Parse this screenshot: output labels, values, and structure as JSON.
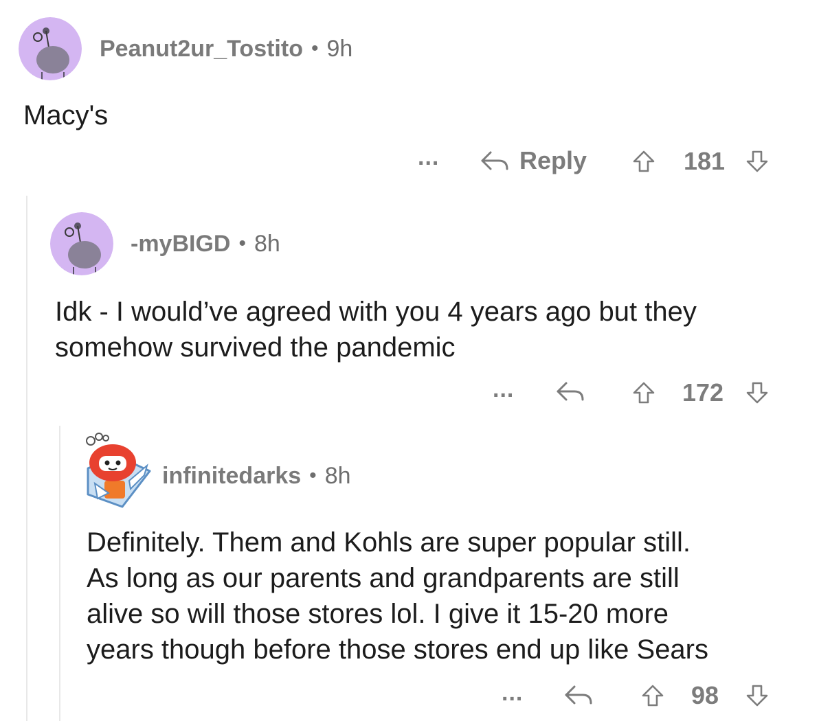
{
  "comments": [
    {
      "username": "Peanut2ur_Tostito",
      "separator": "•",
      "age": "9h",
      "text": "Macy's",
      "more_label": "...",
      "reply_label": "Reply",
      "score": "181"
    },
    {
      "username": "-myBIGD",
      "separator": "•",
      "age": "8h",
      "text_lines": [
        "Idk - I would’ve agreed with you 4 years ago but they",
        "somehow survived the pandemic"
      ],
      "more_label": "...",
      "score": "172"
    },
    {
      "username": "infinitedarks",
      "separator": "•",
      "age": "8h",
      "text_lines": [
        "Definitely. Them and Kohls are super popular still.",
        "As long as our parents and grandparents are still",
        "alive so will those stores lol. I give it 15-20 more",
        "years though before those stores end up like Sears"
      ],
      "more_label": "...",
      "score": "98"
    }
  ],
  "icons": {
    "reply": "reply-arrow-icon",
    "upvote": "upvote-arrow-icon",
    "downvote": "downvote-arrow-icon",
    "avatar": "snoo-avatar-icon"
  },
  "colors": {
    "avatar_bg": "#d4b6f2",
    "snoo_body": "#8a8298",
    "meta": "#6e6e6e",
    "action": "#7c7c7c",
    "thread_line": "#e8e8e8"
  }
}
